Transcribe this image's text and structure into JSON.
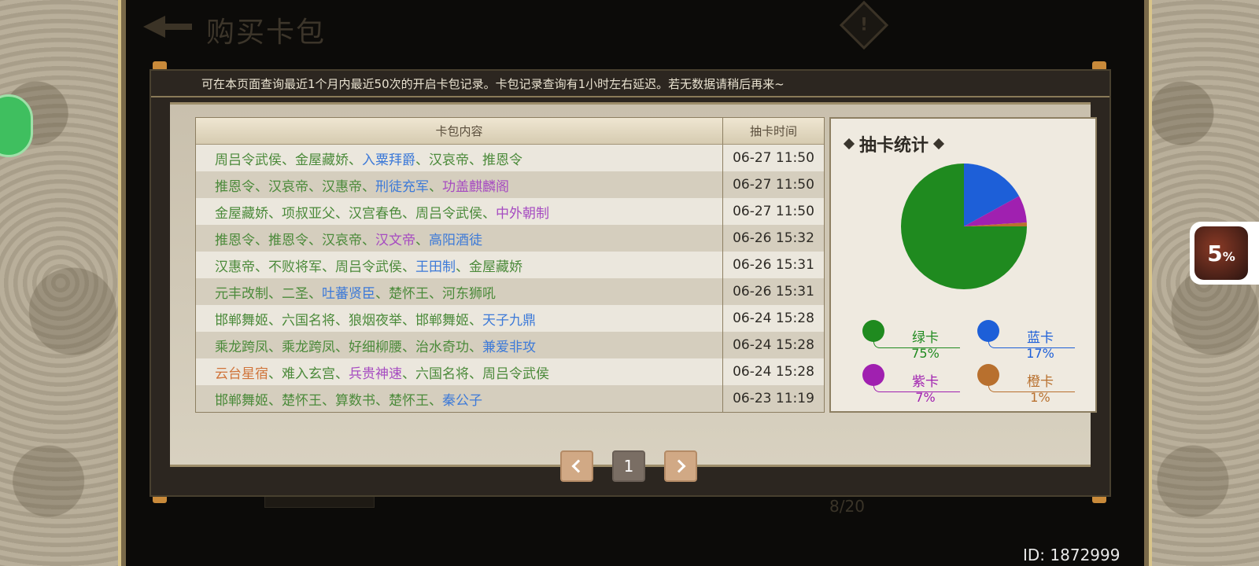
{
  "header": {
    "title": "购买卡包"
  },
  "notice": "可在本页面查询最近1个月内最近50次的开启卡包记录。卡包记录查询有1小时左右延迟。若无数据请稍后再来~",
  "table": {
    "col_content": "卡包内容",
    "col_time": "抽卡时间",
    "rows": [
      {
        "time": "06-27 11:50",
        "cards": [
          {
            "name": "周吕令武侯",
            "color": "#4b8a3a"
          },
          {
            "name": "金屋藏娇",
            "color": "#4b8a3a"
          },
          {
            "name": "入粟拜爵",
            "color": "#3d7ad8"
          },
          {
            "name": "汉哀帝",
            "color": "#4b8a3a"
          },
          {
            "name": "推恩令",
            "color": "#4b8a3a"
          }
        ]
      },
      {
        "time": "06-27 11:50",
        "cards": [
          {
            "name": "推恩令",
            "color": "#4b8a3a"
          },
          {
            "name": "汉哀帝",
            "color": "#4b8a3a"
          },
          {
            "name": "汉惠帝",
            "color": "#4b8a3a"
          },
          {
            "name": "刑徒充军",
            "color": "#3d7ad8"
          },
          {
            "name": "功盖麒麟阁",
            "color": "#a64bc1"
          }
        ]
      },
      {
        "time": "06-27 11:50",
        "cards": [
          {
            "name": "金屋藏娇",
            "color": "#4b8a3a"
          },
          {
            "name": "项叔亚父",
            "color": "#4b8a3a"
          },
          {
            "name": "汉宫春色",
            "color": "#4b8a3a"
          },
          {
            "name": "周吕令武侯",
            "color": "#4b8a3a"
          },
          {
            "name": "中外朝制",
            "color": "#a64bc1"
          }
        ]
      },
      {
        "time": "06-26 15:32",
        "cards": [
          {
            "name": "推恩令",
            "color": "#4b8a3a"
          },
          {
            "name": "推恩令",
            "color": "#4b8a3a"
          },
          {
            "name": "汉哀帝",
            "color": "#4b8a3a"
          },
          {
            "name": "汉文帝",
            "color": "#a64bc1"
          },
          {
            "name": "高阳酒徒",
            "color": "#3d7ad8"
          }
        ]
      },
      {
        "time": "06-26 15:31",
        "cards": [
          {
            "name": "汉惠帝",
            "color": "#4b8a3a"
          },
          {
            "name": "不败将军",
            "color": "#4b8a3a"
          },
          {
            "name": "周吕令武侯",
            "color": "#4b8a3a"
          },
          {
            "name": "王田制",
            "color": "#3d7ad8"
          },
          {
            "name": "金屋藏娇",
            "color": "#4b8a3a"
          }
        ]
      },
      {
        "time": "06-26 15:31",
        "cards": [
          {
            "name": "元丰改制",
            "color": "#4b8a3a"
          },
          {
            "name": "二圣",
            "color": "#4b8a3a"
          },
          {
            "name": "吐蕃贤臣",
            "color": "#3d7ad8"
          },
          {
            "name": "楚怀王",
            "color": "#4b8a3a"
          },
          {
            "name": "河东狮吼",
            "color": "#4b8a3a"
          }
        ]
      },
      {
        "time": "06-24 15:28",
        "cards": [
          {
            "name": "邯郸舞姬",
            "color": "#4b8a3a"
          },
          {
            "name": "六国名将",
            "color": "#4b8a3a"
          },
          {
            "name": "狼烟夜举",
            "color": "#4b8a3a"
          },
          {
            "name": "邯郸舞姬",
            "color": "#4b8a3a"
          },
          {
            "name": "天子九鼎",
            "color": "#3d7ad8"
          }
        ]
      },
      {
        "time": "06-24 15:28",
        "cards": [
          {
            "name": "乘龙跨凤",
            "color": "#4b8a3a"
          },
          {
            "name": "乘龙跨凤",
            "color": "#4b8a3a"
          },
          {
            "name": "好细柳腰",
            "color": "#4b8a3a"
          },
          {
            "name": "治水奇功",
            "color": "#4b8a3a"
          },
          {
            "name": "兼爱非攻",
            "color": "#3d7ad8"
          }
        ]
      },
      {
        "time": "06-24 15:28",
        "cards": [
          {
            "name": "云台星宿",
            "color": "#d0743a"
          },
          {
            "name": "难入玄宫",
            "color": "#4b8a3a"
          },
          {
            "name": "兵贵神速",
            "color": "#a64bc1"
          },
          {
            "name": "六国名将",
            "color": "#4b8a3a"
          },
          {
            "name": "周吕令武侯",
            "color": "#4b8a3a"
          }
        ]
      },
      {
        "time": "06-23 11:19",
        "cards": [
          {
            "name": "邯郸舞姬",
            "color": "#4b8a3a"
          },
          {
            "name": "楚怀王",
            "color": "#4b8a3a"
          },
          {
            "name": "算数书",
            "color": "#4b8a3a"
          },
          {
            "name": "楚怀王",
            "color": "#4b8a3a"
          },
          {
            "name": "秦公子",
            "color": "#3d7ad8"
          }
        ]
      }
    ]
  },
  "stats": {
    "title": "抽卡统计",
    "legend": [
      {
        "label": "绿卡",
        "pct": "75%",
        "color": "#1f8a1f"
      },
      {
        "label": "蓝卡",
        "pct": "17%",
        "color": "#1d5fd8"
      },
      {
        "label": "紫卡",
        "pct": "7%",
        "color": "#a020b0"
      },
      {
        "label": "橙卡",
        "pct": "1%",
        "color": "#b8702e"
      }
    ]
  },
  "chart_data": {
    "type": "pie",
    "title": "抽卡统计",
    "categories": [
      "绿卡",
      "蓝卡",
      "紫卡",
      "橙卡"
    ],
    "values": [
      75,
      17,
      7,
      1
    ],
    "colors": [
      "#1f8a1f",
      "#1d5fd8",
      "#a020b0",
      "#b8702e"
    ]
  },
  "pager": {
    "page": "1"
  },
  "background": {
    "progress": "8/20",
    "id_label": "ID: 1872999"
  },
  "loading_badge": {
    "percent": "5",
    "unit": "%"
  }
}
